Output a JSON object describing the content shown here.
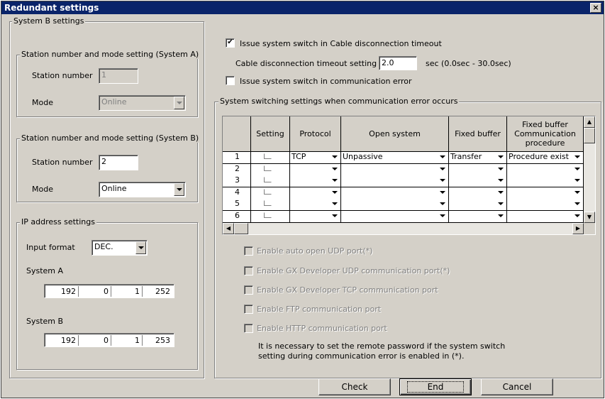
{
  "window": {
    "title": "Redundant settings",
    "close": "×"
  },
  "systemB": {
    "group_label": "System B settings",
    "stationA": {
      "group_label": "Station number and mode setting (System A)",
      "station_label": "Station number",
      "station_value": "1",
      "mode_label": "Mode",
      "mode_value": "Online"
    },
    "stationB": {
      "group_label": "Station number and mode setting (System B)",
      "station_label": "Station number",
      "station_value": "2",
      "mode_label": "Mode",
      "mode_value": "Online"
    },
    "ip": {
      "group_label": "IP address settings",
      "input_format_label": "Input format",
      "input_format_value": "DEC.",
      "systemA_label": "System A",
      "systemA": [
        "192",
        "0",
        "1",
        "252"
      ],
      "systemB_label": "System B",
      "systemB": [
        "192",
        "0",
        "1",
        "253"
      ]
    }
  },
  "cable": {
    "issue_label": "Issue system switch in Cable disconnection timeout",
    "issue_checked": true,
    "timeout_label": "Cable disconnection timeout setting",
    "timeout_value": "2.0",
    "timeout_range": "sec (0.0sec - 30.0sec)",
    "comm_error_label": "Issue system switch in communication error",
    "comm_error_checked": false
  },
  "switching": {
    "group_label": "System switching settings when  communication error occurs",
    "headers": [
      "Setting",
      "Protocol",
      "Open system",
      "Fixed buffer",
      "Fixed buffer Communication procedure"
    ],
    "rows": [
      {
        "num": "1",
        "protocol": "TCP",
        "open": "Unpassive",
        "fixed": "Transfer",
        "proc": "Procedure exist"
      },
      {
        "num": "2",
        "protocol": "",
        "open": "",
        "fixed": "",
        "proc": ""
      },
      {
        "num": "3",
        "protocol": "",
        "open": "",
        "fixed": "",
        "proc": ""
      },
      {
        "num": "4",
        "protocol": "",
        "open": "",
        "fixed": "",
        "proc": ""
      },
      {
        "num": "5",
        "protocol": "",
        "open": "",
        "fixed": "",
        "proc": ""
      },
      {
        "num": "6",
        "protocol": "",
        "open": "",
        "fixed": "",
        "proc": ""
      }
    ],
    "options": [
      "Enable auto open UDP port(*)",
      "Enable GX Developer UDP communication port(*)",
      "Enable GX Developer TCP communication port",
      "Enable FTP communication port",
      "Enable HTTP communication port"
    ],
    "note_line1": "It is necessary to set the remote password if the system switch",
    "note_line2": "setting during communication error is enabled in (*)."
  },
  "buttons": {
    "check": "Check",
    "end": "End",
    "cancel": "Cancel"
  }
}
